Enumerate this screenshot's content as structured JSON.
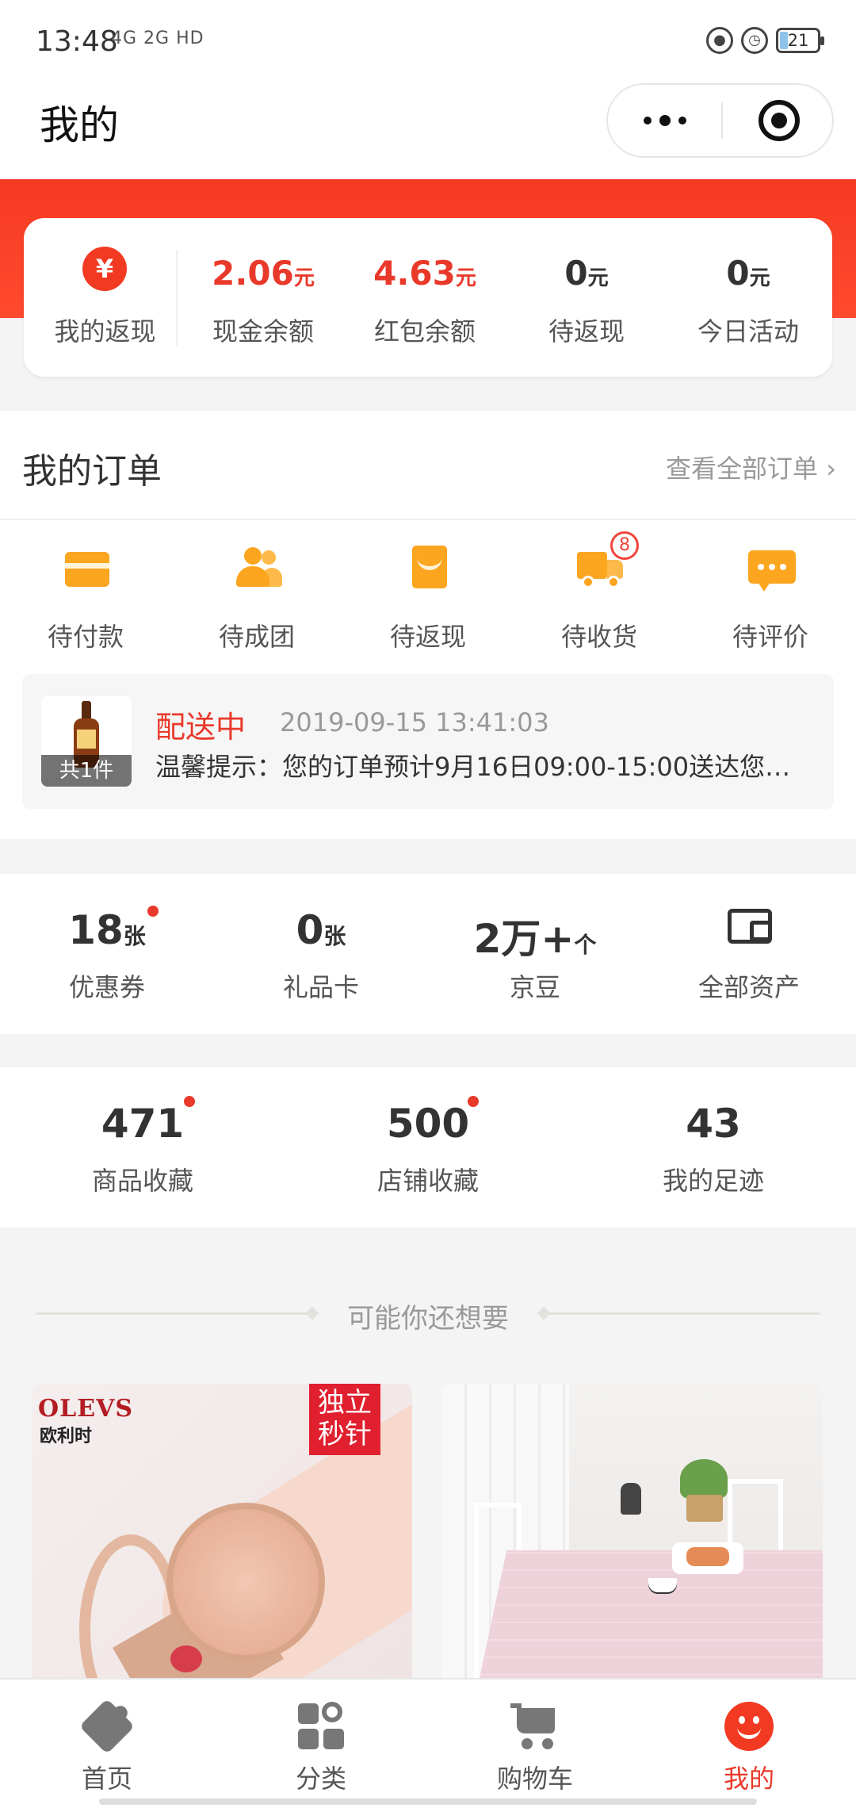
{
  "status_bar": {
    "time": "13:48",
    "network": "4G 2G HD",
    "battery": "21"
  },
  "header": {
    "title": "我的"
  },
  "assets": {
    "rebate_icon": "¥",
    "rebate_label": "我的返现",
    "items": [
      {
        "value": "2.06",
        "unit": "元",
        "label": "现金余额",
        "highlight": true
      },
      {
        "value": "4.63",
        "unit": "元",
        "label": "红包余额",
        "highlight": true
      },
      {
        "value": "0",
        "unit": "元",
        "label": "待返现",
        "highlight": false
      },
      {
        "value": "0",
        "unit": "元",
        "label": "今日活动",
        "highlight": false
      }
    ]
  },
  "orders": {
    "title": "我的订单",
    "view_all": "查看全部订单 ›",
    "statuses": [
      {
        "label": "待付款",
        "icon": "wallet-icon"
      },
      {
        "label": "待成团",
        "icon": "group-icon"
      },
      {
        "label": "待返现",
        "icon": "red-envelope-icon"
      },
      {
        "label": "待收货",
        "icon": "truck-icon",
        "badge": "8"
      },
      {
        "label": "待评价",
        "icon": "comment-icon"
      }
    ],
    "delivery": {
      "count": "共1件",
      "status": "配送中",
      "time": "2019-09-15 13:41:03",
      "tip": "温馨提示：您的订单预计9月16日09:00-15:00送达您…"
    }
  },
  "wallet": {
    "items": [
      {
        "value": "18",
        "unit": "张",
        "label": "优惠券",
        "dot": true
      },
      {
        "value": "0",
        "unit": "张",
        "label": "礼品卡",
        "dot": false
      },
      {
        "value": "2万+",
        "unit": "个",
        "label": "京豆",
        "dot": false
      }
    ],
    "all_assets": "全部资产"
  },
  "stats": [
    {
      "value": "471",
      "label": "商品收藏",
      "dot": true
    },
    {
      "value": "500",
      "label": "店铺收藏",
      "dot": true
    },
    {
      "value": "43",
      "label": "我的足迹",
      "dot": false
    }
  ],
  "recommend": {
    "title": "可能你还想要",
    "watch": {
      "brand": "OLEVS",
      "brand_sub": "欧利时",
      "tag": "独立秒针"
    }
  },
  "tabbar": [
    {
      "label": "首页",
      "icon": "home-icon",
      "active": false
    },
    {
      "label": "分类",
      "icon": "category-icon",
      "active": false
    },
    {
      "label": "购物车",
      "icon": "cart-icon",
      "active": false
    },
    {
      "label": "我的",
      "icon": "profile-icon",
      "active": true
    }
  ],
  "colors": {
    "accent": "#e9392a",
    "orange_icon": "#fca51f",
    "banner": "#f53a22"
  }
}
